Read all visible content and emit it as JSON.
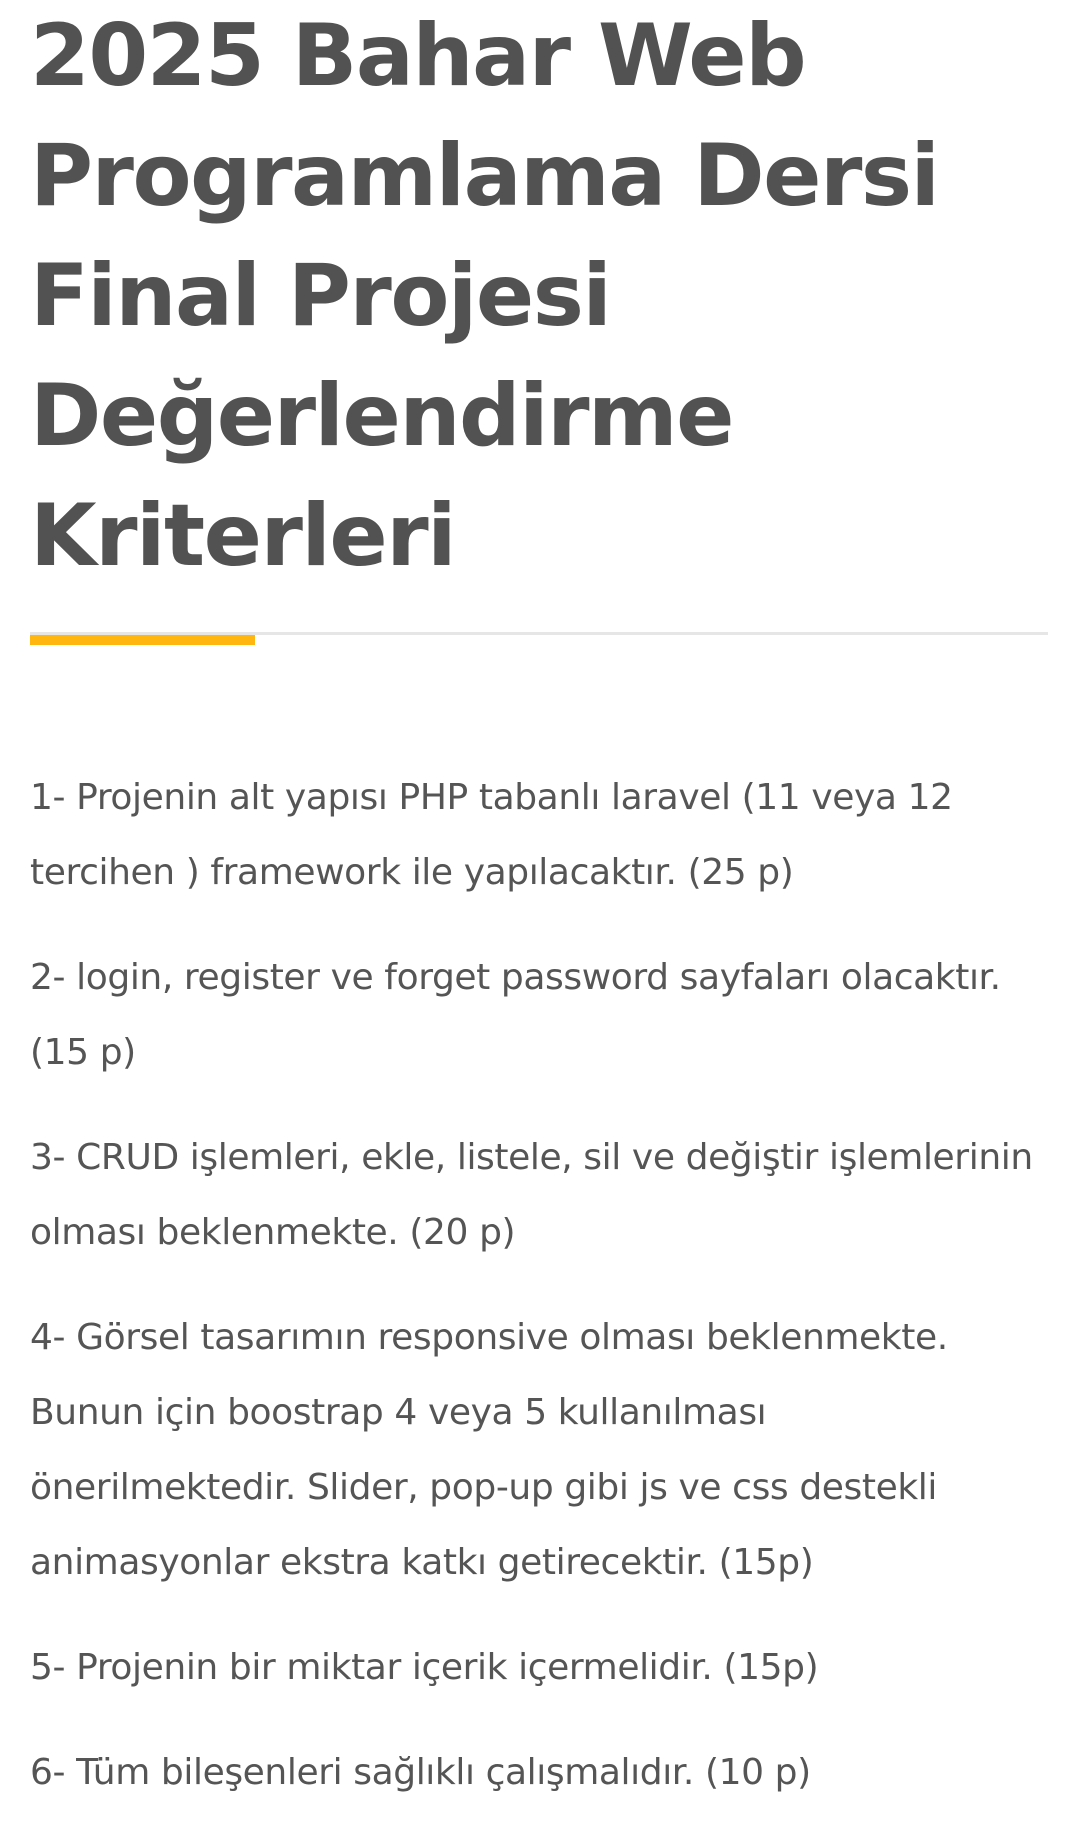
{
  "article": {
    "title_lines": [
      "2025 Bahar Web",
      "Programlama Dersi",
      "Final Projesi",
      "Değerlendirme",
      "Kriterleri"
    ],
    "accent_color": "#ffb60f",
    "items": [
      [
        "1- Projenin alt yapısı PHP tabanlı laravel (11 veya 12",
        "tercihen ) framework ile yapılacaktır. (25 p)"
      ],
      [
        "2- login, register ve forget password sayfaları olacaktır.",
        "(15 p)"
      ],
      [
        "3- CRUD işlemleri, ekle, listele, sil ve değiştir işlemlerinin",
        "olması beklenmekte. (20 p)"
      ],
      [
        "4- Görsel tasarımın responsive olması beklenmekte.",
        "Bunun için boostrap 4 veya 5 kullanılması",
        "önerilmektedir. Slider, pop-up gibi js ve css destekli",
        "animasyonlar ekstra katkı getirecektir. (15p)"
      ],
      [
        "5- Projenin bir miktar içerik içermelidir. (15p)"
      ],
      [
        "6- Tüm bileşenleri sağlıklı çalışmalıdır. (10 p)"
      ]
    ]
  }
}
